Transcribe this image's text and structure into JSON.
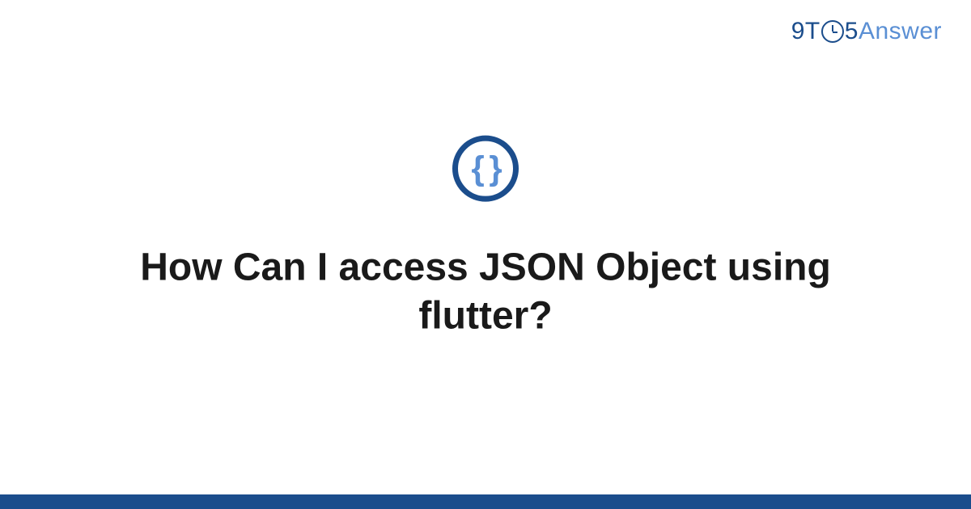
{
  "logo": {
    "part1": "9T",
    "part2": "5",
    "part3": "Answer"
  },
  "icon": {
    "braces": "{ }"
  },
  "title": "How Can I access JSON Object using flutter?"
}
